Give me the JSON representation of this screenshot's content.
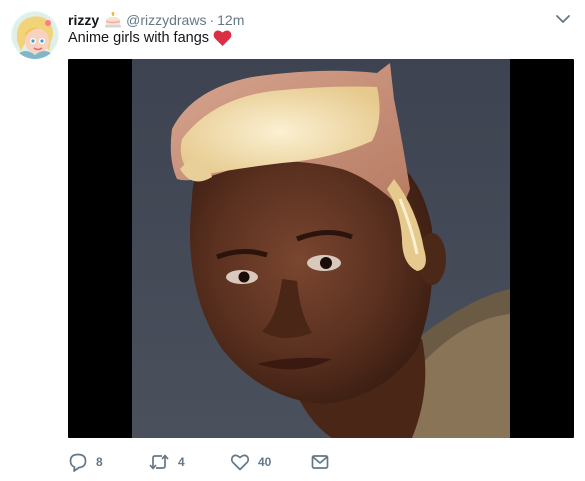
{
  "tweet": {
    "display_name": "rizzy",
    "handle": "@rizzydraws",
    "separator": "·",
    "time": "12m",
    "text": "Anime girls with fangs",
    "icons": {
      "avatar": "cartoon-avatar",
      "name_emoji": "cake-icon",
      "text_emoji": "red-heart-icon",
      "menu": "chevron-down-icon"
    }
  },
  "media": {
    "type": "photo"
  },
  "actions": {
    "reply_count": "8",
    "retweet_count": "4",
    "like_count": "40",
    "icons": [
      "reply-icon",
      "retweet-icon",
      "like-icon",
      "direct-message-icon"
    ]
  },
  "colors": {
    "text": "#14171a",
    "secondary": "#657786",
    "heart": "#e0245e",
    "media_background": "#000000"
  }
}
